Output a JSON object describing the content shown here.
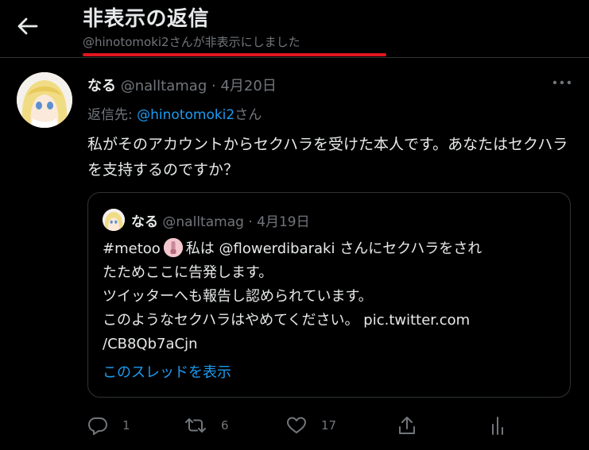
{
  "header": {
    "title": "非表示の返信",
    "subtitle": "@hinotomoki2さんが非表示にしました"
  },
  "tweet": {
    "name": "なる",
    "handle": "@nalltamag",
    "sep": "·",
    "date": "4月20日",
    "reply_prefix": "返信先: ",
    "reply_mention": "@hinotomoki2",
    "reply_suffix": "さん",
    "text": "私がそのアカウントからセクハラを受けた本人です。あなたはセクハラを支持するのですか？"
  },
  "quote": {
    "name": "なる",
    "handle": "@nalltamag",
    "sep": "·",
    "date": "4月19日",
    "line1_hashtag": "#metoo",
    "line1_rest": "私は @flowerdibaraki さんにセクハラをされ",
    "line2": "たためここに告発します。",
    "line3": "ツイッターへも報告し認められています。",
    "line4": "このようなセクハラはやめてください。 pic.twitter.com",
    "line5": "/CB8Qb7aCjn",
    "show_thread": "このスレッドを表示"
  },
  "actions": {
    "reply_count": "1",
    "retweet_count": "6",
    "like_count": "17"
  },
  "colors": {
    "background": "#000000",
    "accent": "#1d9bf0",
    "muted": "#71767b",
    "highlight_underline": "#e0161e"
  }
}
